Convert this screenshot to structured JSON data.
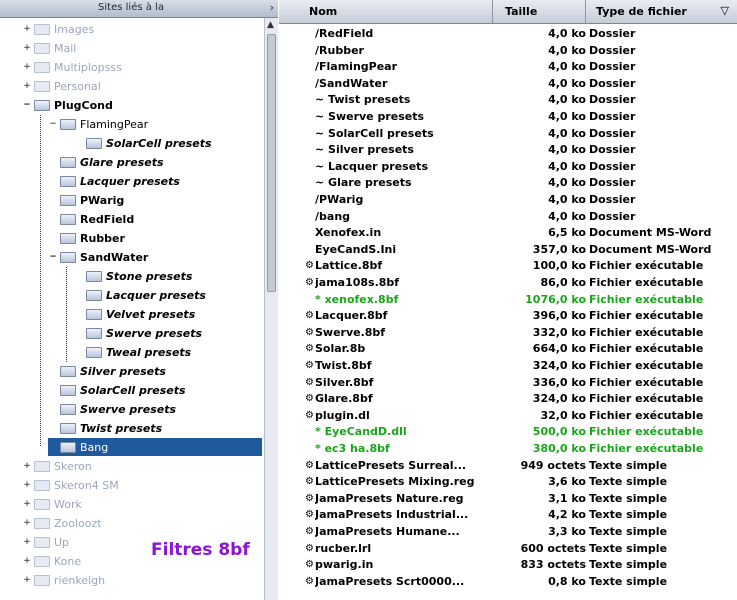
{
  "tree": {
    "header_title": "Sites liés à la",
    "collapse_glyph": "›",
    "scroll_up_glyph": "▲",
    "items": [
      {
        "label": "Images",
        "expander": "+",
        "style": "dim",
        "indent": 0
      },
      {
        "label": "Mail",
        "expander": "+",
        "style": "dim",
        "indent": 0
      },
      {
        "label": "Multiplopsss",
        "expander": "+",
        "style": "dim",
        "indent": 0
      },
      {
        "label": "Personal",
        "expander": "+",
        "style": "dim",
        "indent": 0
      },
      {
        "label": "PlugCond",
        "expander": "−",
        "style": "bold",
        "indent": 0
      },
      {
        "label": "FlamingPear",
        "expander": "−",
        "style": "normal",
        "indent": 1
      },
      {
        "label": "SolarCell presets",
        "expander": "",
        "style": "ital",
        "indent": 2
      },
      {
        "label": "Glare presets",
        "expander": "",
        "style": "ital",
        "indent": 1
      },
      {
        "label": "Lacquer presets",
        "expander": "",
        "style": "ital",
        "indent": 1
      },
      {
        "label": "PWarig",
        "expander": "",
        "style": "bold",
        "indent": 1
      },
      {
        "label": "RedField",
        "expander": "",
        "style": "bold",
        "indent": 1
      },
      {
        "label": "Rubber",
        "expander": "",
        "style": "bold",
        "indent": 1
      },
      {
        "label": "SandWater",
        "expander": "−",
        "style": "bold",
        "indent": 1
      },
      {
        "label": "Stone presets",
        "expander": "",
        "style": "ital",
        "indent": 2
      },
      {
        "label": "Lacquer presets",
        "expander": "",
        "style": "ital",
        "indent": 2
      },
      {
        "label": "Velvet presets",
        "expander": "",
        "style": "ital",
        "indent": 2
      },
      {
        "label": "Swerve presets",
        "expander": "",
        "style": "ital",
        "indent": 2
      },
      {
        "label": "Tweal presets",
        "expander": "",
        "style": "ital",
        "indent": 2
      },
      {
        "label": "Silver presets",
        "expander": "",
        "style": "ital",
        "indent": 1
      },
      {
        "label": "SolarCell presets",
        "expander": "",
        "style": "ital",
        "indent": 1
      },
      {
        "label": "Swerve presets",
        "expander": "",
        "style": "ital",
        "indent": 1
      },
      {
        "label": "Twist presets",
        "expander": "",
        "style": "ital",
        "indent": 1
      },
      {
        "label": "Bang",
        "expander": "",
        "style": "sel",
        "indent": 1
      },
      {
        "label": "Skeron",
        "expander": "+",
        "style": "dim",
        "indent": 0
      },
      {
        "label": "Skeron4 SM",
        "expander": "+",
        "style": "dim",
        "indent": 0
      },
      {
        "label": "Work",
        "expander": "+",
        "style": "dim",
        "indent": 0
      },
      {
        "label": "Zooloozt",
        "expander": "+",
        "style": "dim",
        "indent": 0
      },
      {
        "label": "Up",
        "expander": "+",
        "style": "dim",
        "indent": 0
      },
      {
        "label": "Kone",
        "expander": "+",
        "style": "dim",
        "indent": 0
      },
      {
        "label": "rienkeigh",
        "expander": "+",
        "style": "dim",
        "indent": 0
      }
    ]
  },
  "watermark": "Filtres 8bf",
  "list": {
    "columns": {
      "name": "Nom",
      "size": "Taille",
      "type": "Type de fichier",
      "sort_glyph": "▽"
    },
    "rows": [
      {
        "icon": "",
        "name": "/RedField",
        "size": "4,0 ko",
        "type": "Dossier",
        "color": "black"
      },
      {
        "icon": "",
        "name": "/Rubber",
        "size": "4,0 ko",
        "type": "Dossier",
        "color": "black"
      },
      {
        "icon": "",
        "name": "/FlamingPear",
        "size": "4,0 ko",
        "type": "Dossier",
        "color": "black"
      },
      {
        "icon": "",
        "name": "/SandWater",
        "size": "4,0 ko",
        "type": "Dossier",
        "color": "black"
      },
      {
        "icon": "",
        "name": "~ Twist presets",
        "size": "4,0 ko",
        "type": "Dossier",
        "color": "black"
      },
      {
        "icon": "",
        "name": "~ Swerve presets",
        "size": "4,0 ko",
        "type": "Dossier",
        "color": "black"
      },
      {
        "icon": "",
        "name": "~ SolarCell presets",
        "size": "4,0 ko",
        "type": "Dossier",
        "color": "black"
      },
      {
        "icon": "",
        "name": "~ Silver presets",
        "size": "4,0 ko",
        "type": "Dossier",
        "color": "black"
      },
      {
        "icon": "",
        "name": "~ Lacquer presets",
        "size": "4,0 ko",
        "type": "Dossier",
        "color": "black"
      },
      {
        "icon": "",
        "name": "~ Glare presets",
        "size": "4,0 ko",
        "type": "Dossier",
        "color": "black"
      },
      {
        "icon": "",
        "name": "/PWarig",
        "size": "4,0 ko",
        "type": "Dossier",
        "color": "black"
      },
      {
        "icon": "",
        "name": "/bang",
        "size": "4,0 ko",
        "type": "Dossier",
        "color": "black"
      },
      {
        "icon": "",
        "name": "Xenofex.in",
        "size": "6,5 ko",
        "type": "Document MS-Word",
        "color": "black"
      },
      {
        "icon": "",
        "name": "EyeCandS.Ini",
        "size": "357,0 ko",
        "type": "Document MS-Word",
        "color": "black"
      },
      {
        "icon": "⚙",
        "name": "Lattice.8bf",
        "size": "100,0 ko",
        "type": "Fichier exécutable",
        "color": "black"
      },
      {
        "icon": "⚙",
        "name": "jama108s.8bf",
        "size": "86,0 ko",
        "type": "Fichier exécutable",
        "color": "black"
      },
      {
        "icon": "",
        "name": "* xenofex.8bf",
        "size": "1076,0 ko",
        "type": "Fichier exécutable",
        "color": "green"
      },
      {
        "icon": "⚙",
        "name": "Lacquer.8bf",
        "size": "396,0 ko",
        "type": "Fichier exécutable",
        "color": "black"
      },
      {
        "icon": "⚙",
        "name": "Swerve.8bf",
        "size": "332,0 ko",
        "type": "Fichier exécutable",
        "color": "black"
      },
      {
        "icon": "⚙",
        "name": "Solar.8b",
        "size": "664,0 ko",
        "type": "Fichier exécutable",
        "color": "black"
      },
      {
        "icon": "⚙",
        "name": "Twist.8bf",
        "size": "324,0 ko",
        "type": "Fichier exécutable",
        "color": "black"
      },
      {
        "icon": "⚙",
        "name": "Silver.8bf",
        "size": "336,0 ko",
        "type": "Fichier exécutable",
        "color": "black"
      },
      {
        "icon": "⚙",
        "name": "Glare.8bf",
        "size": "324,0 ko",
        "type": "Fichier exécutable",
        "color": "black"
      },
      {
        "icon": "⚙",
        "name": "plugin.dl",
        "size": "32,0 ko",
        "type": "Fichier exécutable",
        "color": "black"
      },
      {
        "icon": "",
        "name": "* EyeCandD.dll",
        "size": "500,0 ko",
        "type": "Fichier exécutable",
        "color": "green"
      },
      {
        "icon": "",
        "name": "* ec3 ha.8bf",
        "size": "380,0 ko",
        "type": "Fichier exécutable",
        "color": "green"
      },
      {
        "icon": "⚙",
        "name": "LatticePresets Surreal...",
        "size": "949 octets",
        "type": "Texte simple",
        "color": "black"
      },
      {
        "icon": "⚙",
        "name": "LatticePresets Mixing.reg",
        "size": "3,6 ko",
        "type": "Texte simple",
        "color": "black"
      },
      {
        "icon": "⚙",
        "name": "JamaPresets Nature.reg",
        "size": "3,1 ko",
        "type": "Texte simple",
        "color": "black"
      },
      {
        "icon": "⚙",
        "name": "JamaPresets Industrial...",
        "size": "4,2 ko",
        "type": "Texte simple",
        "color": "black"
      },
      {
        "icon": "⚙",
        "name": "JamaPresets Humane...",
        "size": "3,3 ko",
        "type": "Texte simple",
        "color": "black"
      },
      {
        "icon": "⚙",
        "name": "rucber.lrl",
        "size": "600 octets",
        "type": "Texte simple",
        "color": "black"
      },
      {
        "icon": "⚙",
        "name": "pwarig.in",
        "size": "833 octets",
        "type": "Texte simple",
        "color": "black"
      },
      {
        "icon": "⚙",
        "name": "JamaPresets Scrt0000...",
        "size": "0,8 ko",
        "type": "Texte simple",
        "color": "black"
      }
    ]
  }
}
